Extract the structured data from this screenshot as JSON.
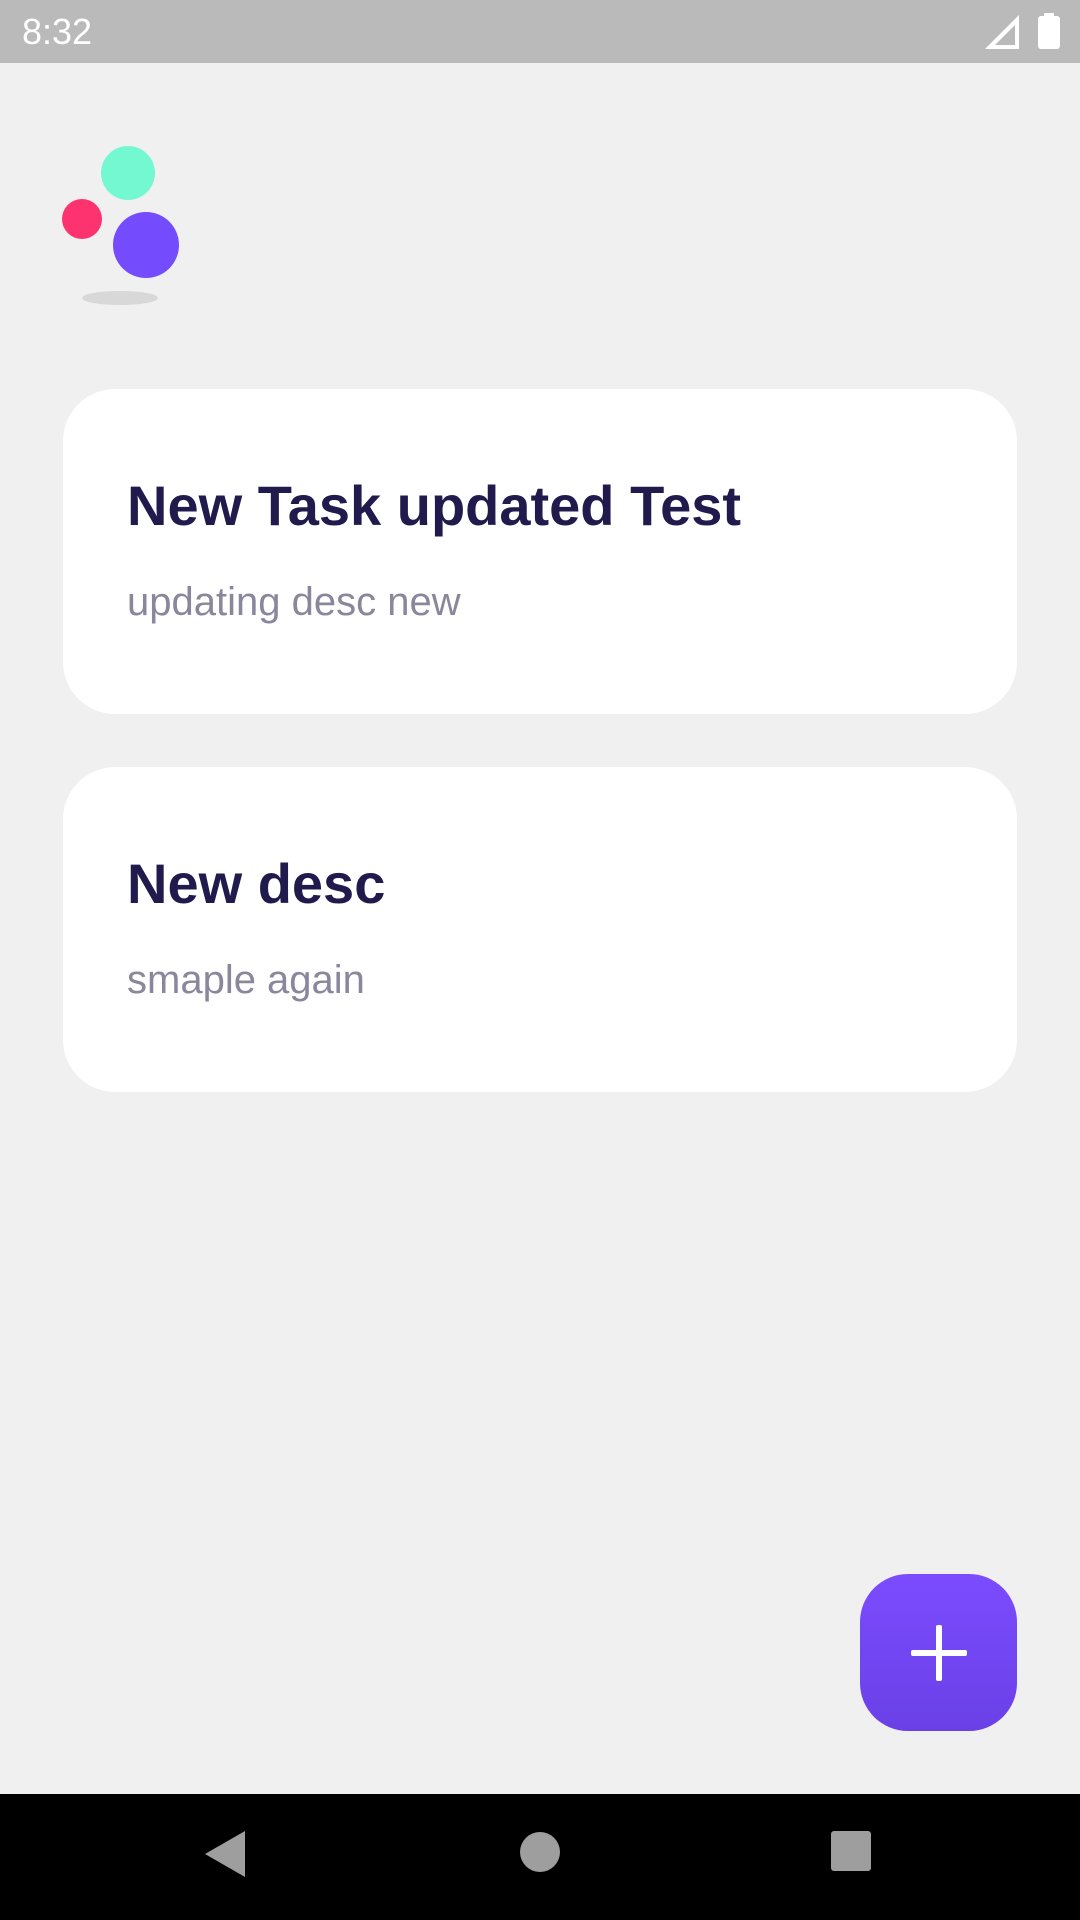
{
  "status_bar": {
    "time": "8:32",
    "icons": [
      "signal-icon",
      "battery-icon"
    ]
  },
  "logo": {
    "icon": "app-logo-icon",
    "colors": {
      "teal": "#74f8d2",
      "pink": "#fc336f",
      "purple": "#744cfd"
    }
  },
  "tasks": [
    {
      "title": "New Task updated Test",
      "description": "updating desc new"
    },
    {
      "title": "New desc",
      "description": "smaple again"
    }
  ],
  "fab": {
    "icon": "plus-icon",
    "color": "#7445f5"
  },
  "nav_bar": {
    "icons": [
      "back-icon",
      "home-icon",
      "recents-icon"
    ]
  },
  "colors": {
    "background": "#f0f0f0",
    "card": "#ffffff",
    "title_text": "#211a4d",
    "desc_text": "#8a879c",
    "status_bar": "#bababa",
    "nav_bar": "#000000"
  }
}
